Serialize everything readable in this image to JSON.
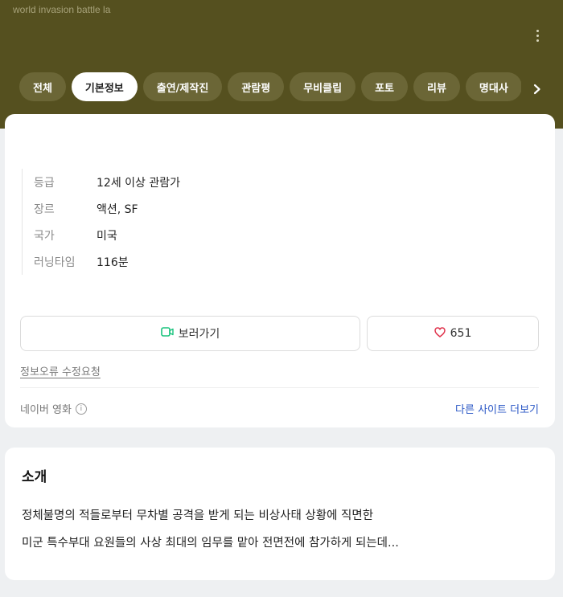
{
  "header": {
    "title": "world invasion battle la"
  },
  "tabs": [
    {
      "label": "전체",
      "active": false
    },
    {
      "label": "기본정보",
      "active": true
    },
    {
      "label": "출연/제작진",
      "active": false
    },
    {
      "label": "관람평",
      "active": false
    },
    {
      "label": "무비클립",
      "active": false
    },
    {
      "label": "포토",
      "active": false
    },
    {
      "label": "리뷰",
      "active": false
    },
    {
      "label": "명대사",
      "active": false
    }
  ],
  "info": {
    "rows": [
      {
        "label": "등급",
        "value": "12세 이상 관람가"
      },
      {
        "label": "장르",
        "value": "액션, SF"
      },
      {
        "label": "국가",
        "value": "미국"
      },
      {
        "label": "러닝타임",
        "value": "116분"
      }
    ]
  },
  "actions": {
    "watch_label": "보러가기",
    "like_count": "651"
  },
  "report_link": "정보오류 수정요청",
  "source": {
    "name": "네이버 영화",
    "more_sites": "다른 사이트 더보기"
  },
  "intro": {
    "title": "소개",
    "lines": [
      "정체불명의 적들로부터 무차별 공격을 받게 되는 비상사태 상황에 직면한",
      "미군 특수부대 요원들의 사상 최대의 임무를 맡아 전면전에 참가하게 되는데..."
    ]
  },
  "colors": {
    "header_bg": "#55501f",
    "tab_bg": "#6b6636",
    "link_blue": "#2a57c6",
    "watch_icon": "#19c37d",
    "heart": "#e0344d"
  },
  "icons": {
    "more": "more-vertical-icon",
    "next": "chevron-right-icon",
    "watch": "play-video-icon",
    "like": "heart-icon",
    "info": "info-circle-icon"
  }
}
